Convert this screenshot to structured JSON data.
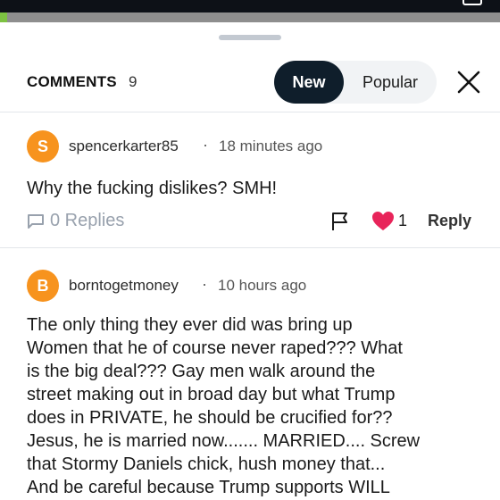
{
  "status_bar": {
    "progress_percent": 1.5
  },
  "header": {
    "title": "COMMENTS",
    "count": "9",
    "sort": {
      "options": [
        "New",
        "Popular"
      ],
      "selected": "New"
    },
    "close_icon": "close-icon"
  },
  "comments": [
    {
      "avatar_letter": "S",
      "avatar_color": "#f7931e",
      "author": "spencerkarter85",
      "separator": "·",
      "time": "18 minutes ago",
      "body": "Why the fucking dislikes? SMH!",
      "replies_label": "0 Replies",
      "likes": "1",
      "reply_label": "Reply"
    },
    {
      "avatar_letter": "B",
      "avatar_color": "#f7931e",
      "author": "borntogetmoney",
      "separator": "·",
      "time": "10 hours ago",
      "body": "The only thing they ever did was bring up\nWomen that he of course never raped??? What\nis the big deal??? Gay men walk around the\nstreet making out in broad day but what Trump\ndoes in PRIVATE, he should be crucified for??\nJesus, he is married now....... MARRIED.... Screw\nthat Stormy Daniels chick, hush money that...\nAnd be careful because Trump supports WILL"
    }
  ],
  "colors": {
    "accent_dark": "#0f1e2b",
    "avatar": "#f7931e",
    "heart": "#e8245a",
    "muted": "#98a1ad",
    "progress": "#7dc242"
  }
}
